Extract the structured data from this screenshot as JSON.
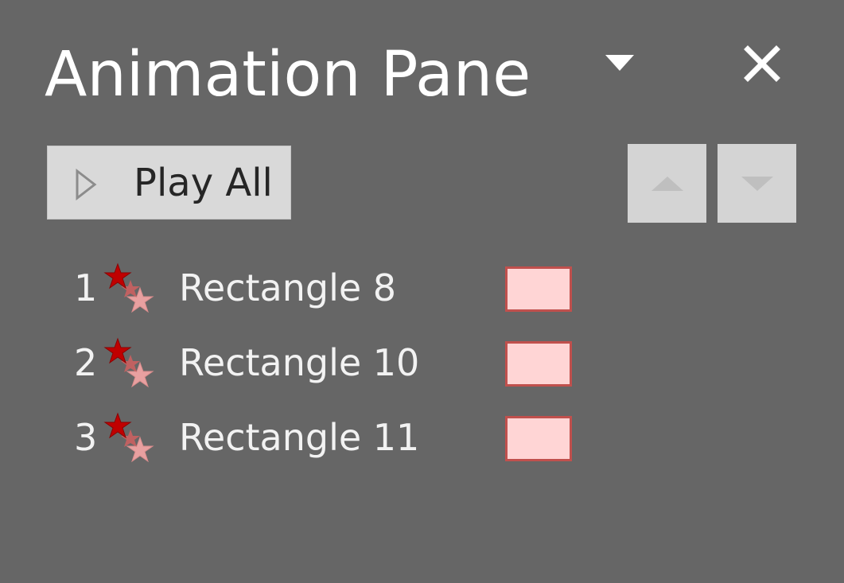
{
  "pane": {
    "title": "Animation Pane"
  },
  "header": {
    "options_icon": "chevron-down-triangle",
    "close_icon": "close-x"
  },
  "toolbar": {
    "play_all_label": "Play All",
    "play_icon": "play-triangle",
    "move_up_icon": "up-triangle",
    "move_down_icon": "down-triangle"
  },
  "animations": [
    {
      "number": "1",
      "name": "Rectangle 8",
      "effect_icon": "emphasis-star"
    },
    {
      "number": "2",
      "name": "Rectangle 10",
      "effect_icon": "emphasis-star"
    },
    {
      "number": "3",
      "name": "Rectangle 11",
      "effect_icon": "emphasis-star"
    }
  ],
  "colors": {
    "background": "#666666",
    "button_fill": "#d9d9d9",
    "timing_bar_fill": "#ffd5d5",
    "timing_bar_border": "#c0504d",
    "star_primary": "#c00000",
    "star_secondary": "#e8a0a0"
  }
}
